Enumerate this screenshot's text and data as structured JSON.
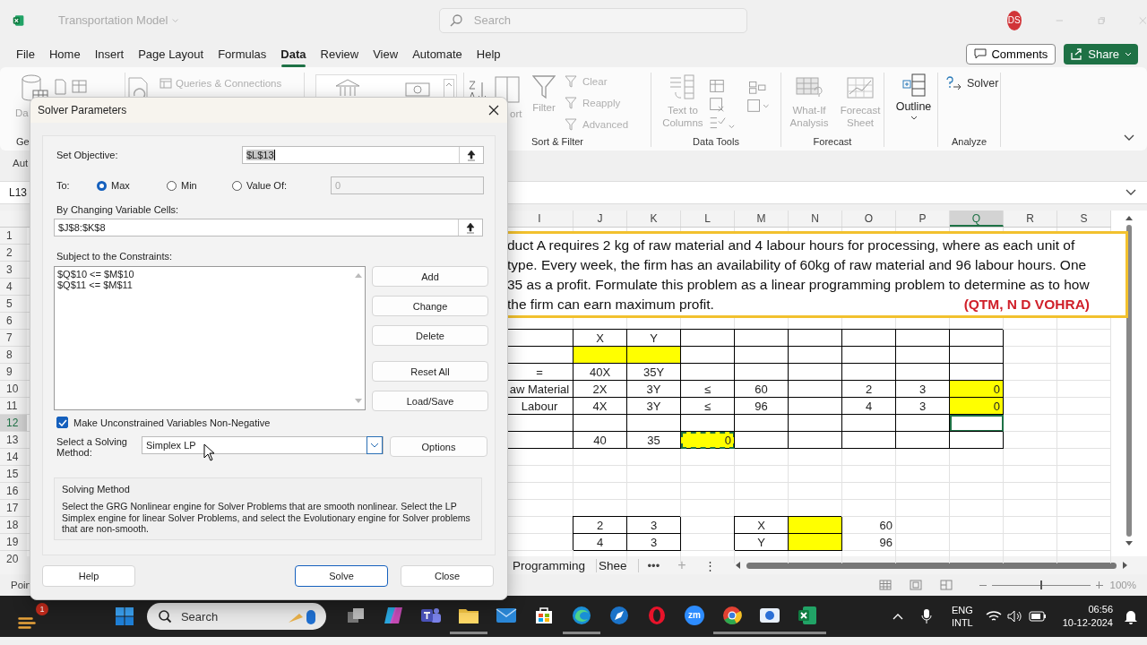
{
  "titlebar": {
    "title": "Transportation Model",
    "search": {
      "placeholder": "Search"
    },
    "avatar": "DS"
  },
  "menu": {
    "tabs": [
      {
        "label": "File",
        "selected": false
      },
      {
        "label": "Home",
        "selected": false
      },
      {
        "label": "Insert",
        "selected": false
      },
      {
        "label": "Page Layout",
        "selected": false
      },
      {
        "label": "Formulas",
        "selected": false
      },
      {
        "label": "Data",
        "selected": true
      },
      {
        "label": "Review",
        "selected": false
      },
      {
        "label": "View",
        "selected": false
      },
      {
        "label": "Automate",
        "selected": false
      },
      {
        "label": "Help",
        "selected": false
      }
    ],
    "comments": "Comments",
    "share": "Share"
  },
  "ribbon": {
    "get_data": {
      "label": "Da",
      "disabled": true,
      "group_label": "Ge"
    },
    "queries": {
      "label": "Queries & Connections",
      "disabled": true
    },
    "sort": {
      "label": "ort",
      "disabled": true
    },
    "filter": {
      "label": "Filter",
      "disabled": true
    },
    "filter_items": [
      {
        "label": "Clear",
        "disabled": true
      },
      {
        "label": "Reapply",
        "disabled": true
      },
      {
        "label": "Advanced",
        "disabled": true
      }
    ],
    "sort_group_label": "Sort & Filter",
    "text_to_columns": {
      "label": "Text to Columns",
      "disabled": true
    },
    "data_tools_label": "Data Tools",
    "what_if": {
      "label": "What-If Analysis",
      "disabled": true
    },
    "forecast_sheet": {
      "label": "Forecast Sheet",
      "disabled": true
    },
    "forecast_label": "Forecast",
    "outline": {
      "label": "Outline",
      "disabled": false
    },
    "solver": {
      "label": "Solver",
      "disabled": false
    },
    "analyze_label": "Analyze"
  },
  "notice_bar": {
    "text": "Aut"
  },
  "formula_bar": {
    "name_box": "L13"
  },
  "sheet": {
    "columns": [
      {
        "label": "I",
        "selected": false
      },
      {
        "label": "J",
        "selected": false
      },
      {
        "label": "K",
        "selected": false
      },
      {
        "label": "L",
        "selected": false
      },
      {
        "label": "M",
        "selected": false
      },
      {
        "label": "N",
        "selected": false
      },
      {
        "label": "O",
        "selected": false
      },
      {
        "label": "P",
        "selected": false
      },
      {
        "label": "Q",
        "selected": true
      },
      {
        "label": "R",
        "selected": false
      },
      {
        "label": "S",
        "selected": false
      }
    ],
    "rows": [
      {
        "number": "1",
        "selected": false
      },
      {
        "number": "2",
        "selected": false
      },
      {
        "number": "3",
        "selected": false
      },
      {
        "number": "4",
        "selected": false
      },
      {
        "number": "5",
        "selected": false
      },
      {
        "number": "6",
        "selected": false
      },
      {
        "number": "7",
        "selected": false,
        "cells": [
          {
            "kind": "boxed"
          },
          {
            "kind": "boxed",
            "text": "X"
          },
          {
            "kind": "boxed",
            "text": "Y"
          },
          {
            "kind": "boxed"
          },
          {
            "kind": "boxed"
          },
          {
            "kind": "boxed"
          },
          {
            "kind": "boxed"
          },
          {
            "kind": "boxed"
          },
          {
            "kind": "boxed"
          },
          null,
          null
        ]
      },
      {
        "number": "8",
        "selected": false,
        "cells": [
          {
            "kind": "boxed"
          },
          {
            "kind": "filled"
          },
          {
            "kind": "filled"
          },
          {
            "kind": "boxed"
          },
          {
            "kind": "boxed"
          },
          {
            "kind": "boxed"
          },
          {
            "kind": "boxed"
          },
          {
            "kind": "boxed"
          },
          {
            "kind": "boxed"
          },
          null,
          null
        ]
      },
      {
        "number": "9",
        "selected": false,
        "cells": [
          {
            "kind": "boxed",
            "text": "="
          },
          {
            "kind": "boxed",
            "text": "40X"
          },
          {
            "kind": "boxed",
            "text": "35Y"
          },
          {
            "kind": "boxed"
          },
          {
            "kind": "boxed"
          },
          {
            "kind": "boxed"
          },
          {
            "kind": "boxed"
          },
          {
            "kind": "boxed"
          },
          {
            "kind": "boxed"
          },
          null,
          null
        ]
      },
      {
        "number": "10",
        "selected": false,
        "cells": [
          {
            "kind": "boxed",
            "text": "aw Material"
          },
          {
            "kind": "boxed",
            "text": "2X"
          },
          {
            "kind": "boxed",
            "text": "3Y"
          },
          {
            "kind": "boxed",
            "text": "≤"
          },
          {
            "kind": "boxed",
            "text": "60"
          },
          {
            "kind": "boxed"
          },
          {
            "kind": "boxed",
            "text": "2"
          },
          {
            "kind": "boxed",
            "text": "3"
          },
          {
            "kind": "filled",
            "number": "0"
          },
          null,
          null
        ]
      },
      {
        "number": "11",
        "selected": false,
        "cells": [
          {
            "kind": "boxed",
            "text": "Labour"
          },
          {
            "kind": "boxed",
            "text": "4X"
          },
          {
            "kind": "boxed",
            "text": "3Y"
          },
          {
            "kind": "boxed",
            "text": "≤"
          },
          {
            "kind": "boxed",
            "text": "96"
          },
          {
            "kind": "boxed"
          },
          {
            "kind": "boxed",
            "text": "4"
          },
          {
            "kind": "boxed",
            "text": "3"
          },
          {
            "kind": "filled",
            "number": "0"
          },
          null,
          null
        ]
      },
      {
        "number": "12",
        "selected": true,
        "cells": [
          {
            "kind": "boxed"
          },
          {
            "kind": "boxed"
          },
          {
            "kind": "boxed"
          },
          {
            "kind": "boxed"
          },
          {
            "kind": "boxed"
          },
          {
            "kind": "boxed"
          },
          {
            "kind": "boxed"
          },
          {
            "kind": "boxed"
          },
          {
            "kind": "active"
          },
          null,
          null
        ]
      },
      {
        "number": "13",
        "selected": false,
        "cells": [
          {
            "kind": "boxed"
          },
          {
            "kind": "boxed",
            "text": "40"
          },
          {
            "kind": "boxed",
            "text": "35"
          },
          {
            "kind": "copied",
            "number": "0"
          },
          {
            "kind": "boxed"
          },
          {
            "kind": "boxed"
          },
          {
            "kind": "boxed"
          },
          {
            "kind": "boxed"
          },
          {
            "kind": "boxed"
          },
          null,
          null
        ]
      },
      {
        "number": "14",
        "selected": false
      },
      {
        "number": "15",
        "selected": false
      },
      {
        "number": "16",
        "selected": false
      },
      {
        "number": "17",
        "selected": false
      },
      {
        "number": "18",
        "selected": false,
        "cells": [
          null,
          {
            "kind": "boxed",
            "text": "2"
          },
          {
            "kind": "boxed",
            "text": "3"
          },
          null,
          {
            "kind": "boxed",
            "text": "X"
          },
          {
            "kind": "filled"
          },
          {
            "kind": "plain",
            "number": "60"
          },
          null,
          null,
          null,
          null
        ]
      },
      {
        "number": "19",
        "selected": false,
        "cells": [
          null,
          {
            "kind": "boxed",
            "text": "4"
          },
          {
            "kind": "boxed",
            "text": "3"
          },
          null,
          {
            "kind": "boxed",
            "text": "Y"
          },
          {
            "kind": "filled"
          },
          {
            "kind": "plain",
            "number": "96"
          },
          null,
          null,
          null,
          null
        ]
      },
      {
        "number": "20",
        "selected": false
      }
    ],
    "text_box": {
      "lines": [
        "duct A requires 2 kg of raw material and 4 labour hours for processing, where as each  unit of",
        "type. Every week, the firm has an availability of 60kg of raw material and 96 labour hours. One",
        "35 as a profit. Formulate this problem as a linear programming problem to determine as to how",
        "the firm can earn maximum profit."
      ],
      "source": "(QTM, N D VOHRA)"
    }
  },
  "sheet_tabs": {
    "tabs": [
      {
        "label": "Programming",
        "selected": false
      },
      {
        "label": "Shee",
        "selected": false
      }
    ],
    "more": "•••",
    "add": "+",
    "options": "⋮"
  },
  "status_bar": {
    "text": "Poin",
    "zoom": {
      "level": 0.5,
      "reading": "100%"
    }
  },
  "dialog": {
    "title": "Solver Parameters",
    "objective": {
      "label": "Set Objective:",
      "value": "$L$13"
    },
    "to": {
      "label": "To:",
      "options": [
        {
          "label": "Max",
          "selected": true
        },
        {
          "label": "Min",
          "selected": false
        },
        {
          "label": "Value Of:",
          "selected": false
        }
      ],
      "value_field": {
        "value": "0",
        "disabled": true
      }
    },
    "changing": {
      "label": "By Changing Variable Cells:",
      "value": "$J$8:$K$8"
    },
    "constraints": {
      "label": "Subject to the Constraints:",
      "items": [
        "$Q$10 <= $M$10",
        "$Q$11 <= $M$11"
      ]
    },
    "side_buttons": [
      "Add",
      "Change",
      "Delete",
      "Reset All",
      "Load/Save"
    ],
    "nonnegative": {
      "label": "Make Unconstrained Variables Non-Negative",
      "checked": true
    },
    "method": {
      "label": "Select a Solving Method:",
      "value": "Simplex LP"
    },
    "options_button": "Options",
    "info": {
      "title": "Solving Method",
      "text": "Select the GRG Nonlinear engine for Solver Problems that are smooth nonlinear. Select the LP Simplex engine for linear Solver Problems, and select the Evolutionary engine for Solver problems that are non-smooth."
    },
    "footer_buttons": [
      {
        "label": "Help",
        "default": false
      },
      {
        "label": "Solve",
        "default": true
      },
      {
        "label": "Close",
        "default": false
      }
    ]
  },
  "taskbar": {
    "weather_badge": "1",
    "search": {
      "placeholder": "Search"
    },
    "apps": [
      {
        "kind": "taskview",
        "active": false
      },
      {
        "kind": "copilot",
        "active": false
      },
      {
        "kind": "teams",
        "active": false
      },
      {
        "kind": "explorer",
        "active": true
      },
      {
        "kind": "mail",
        "active": false
      },
      {
        "kind": "store",
        "active": false
      },
      {
        "kind": "edge",
        "active": true
      },
      {
        "kind": "compass",
        "active": false
      },
      {
        "kind": "opera",
        "active": false
      },
      {
        "kind": "zoom",
        "label": "zm",
        "active": false
      },
      {
        "kind": "chrome",
        "active": true
      },
      {
        "kind": "camera",
        "active": true
      },
      {
        "kind": "excel",
        "active": true
      }
    ],
    "language": [
      "ENG",
      "INTL"
    ],
    "time": "06:56",
    "date": "10-12-2024"
  }
}
